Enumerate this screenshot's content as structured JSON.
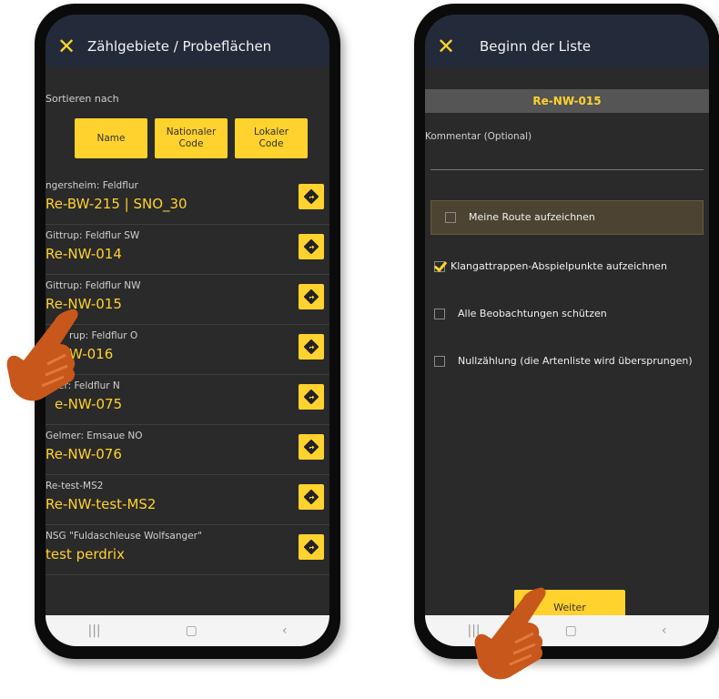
{
  "left": {
    "title": "Zählgebiete / Probeflächen",
    "sort_label": "Sortieren nach",
    "sort_buttons": [
      "Name",
      "Nationaler\nCode",
      "Lokaler\nCode"
    ],
    "rows": [
      {
        "sub": "ngersheim: Feldflur",
        "main": "Re-BW-215 | SNO_30"
      },
      {
        "sub": "Gittrup: Feldflur SW",
        "main": "Re-NW-014"
      },
      {
        "sub": "Gittrup: Feldflur NW",
        "main": "Re-NW-015"
      },
      {
        "sub": "rup: Feldflur O",
        "main": "W-016"
      },
      {
        "sub": "er: Feldflur N",
        "main": "e-NW-075"
      },
      {
        "sub": "Gelmer: Emsaue NO",
        "main": "Re-NW-076"
      },
      {
        "sub": "Re-test-MS2",
        "main": "Re-NW-test-MS2"
      },
      {
        "sub": "NSG \"Fuldaschleuse Wolfsanger\"",
        "main": "test perdrix"
      }
    ],
    "nav_icons": [
      "recents-icon",
      "home-icon",
      "back-icon"
    ]
  },
  "right": {
    "title": "Beginn der Liste",
    "code": "Re-NW-015",
    "comment_label": "Kommentar (Optional)",
    "options": [
      {
        "label": "Meine Route aufzeichnen",
        "checked": false
      },
      {
        "label": "Klangattrappen-Abspielpunkte aufzeichnen",
        "checked": true
      },
      {
        "label": "Alle Beobachtungen schützen",
        "checked": false
      },
      {
        "label": "Nullzählung (die Artenliste wird übersprungen)",
        "checked": false
      }
    ],
    "continue_label": "Weiter"
  },
  "colors": {
    "accent": "#ffd22e",
    "appbar": "#232b3a",
    "background": "#2a2a2a",
    "hand": "#c8571b"
  }
}
